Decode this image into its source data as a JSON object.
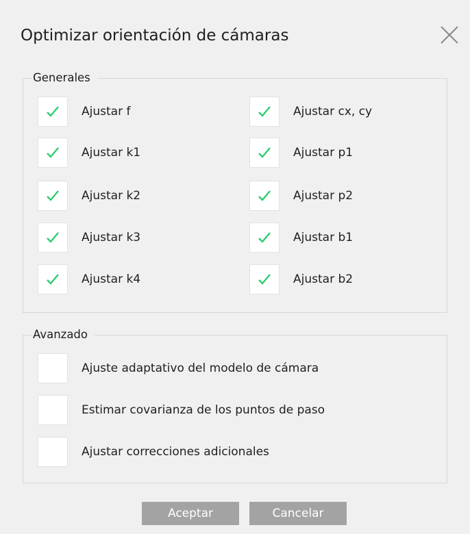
{
  "dialog": {
    "title": "Optimizar orientación de cámaras",
    "close_icon": "close-icon"
  },
  "general": {
    "legend": "Generales",
    "options": [
      {
        "label": "Ajustar f",
        "checked": true
      },
      {
        "label": "Ajustar cx, cy",
        "checked": true
      },
      {
        "label": "Ajustar k1",
        "checked": true
      },
      {
        "label": "Ajustar p1",
        "checked": true
      },
      {
        "label": "Ajustar k2",
        "checked": true
      },
      {
        "label": "Ajustar p2",
        "checked": true
      },
      {
        "label": "Ajustar k3",
        "checked": true
      },
      {
        "label": "Ajustar b1",
        "checked": true
      },
      {
        "label": "Ajustar k4",
        "checked": true
      },
      {
        "label": "Ajustar b2",
        "checked": true
      }
    ]
  },
  "advanced": {
    "legend": "Avanzado",
    "options": [
      {
        "label": "Ajuste adaptativo del modelo de cámara",
        "checked": false
      },
      {
        "label": "Estimar covarianza de los puntos de paso",
        "checked": false
      },
      {
        "label": "Ajustar correcciones adicionales",
        "checked": false
      }
    ]
  },
  "buttons": {
    "accept": "Aceptar",
    "cancel": "Cancelar"
  },
  "colors": {
    "check": "#2ecc71",
    "background": "#f0f0f0",
    "button": "#a3a3a3"
  }
}
